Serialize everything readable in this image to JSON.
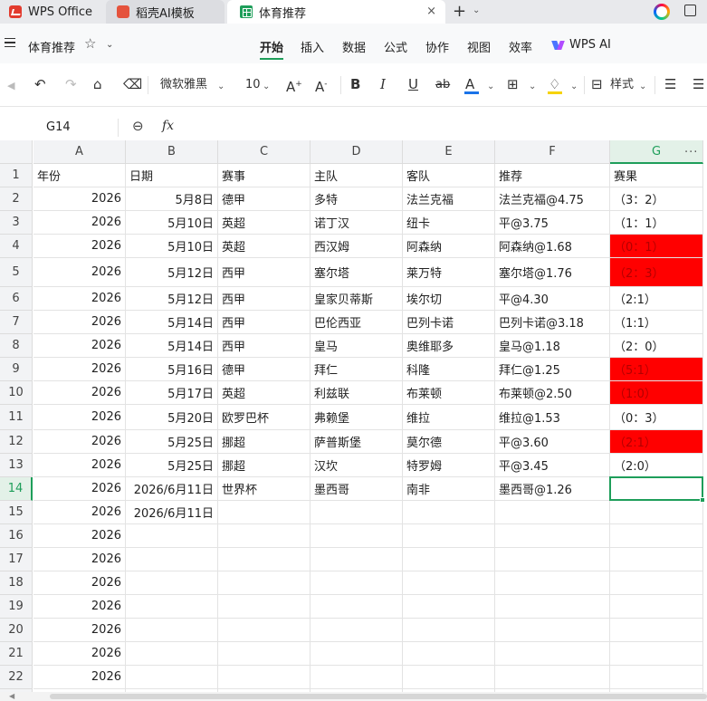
{
  "tabs": {
    "app": "WPS Office",
    "template": "稻壳AI模板",
    "document": "体育推荐",
    "close": "×",
    "new": "+",
    "new_menu": "⌄"
  },
  "menubar": {
    "doc_title": "体育推荐",
    "items": [
      "开始",
      "插入",
      "数据",
      "公式",
      "协作",
      "视图",
      "效率",
      "WPS AI"
    ],
    "active": "开始"
  },
  "toolbar": {
    "font_name": "微软雅黑",
    "font_size": "10",
    "style_label": "样式",
    "font_color": "#1a73e8",
    "fill_color": "#f6d300"
  },
  "formula_bar": {
    "cell_ref": "G14",
    "fx": "fx",
    "value": ""
  },
  "sheet": {
    "columns": [
      "A",
      "B",
      "C",
      "D",
      "E",
      "F",
      "G"
    ],
    "selected_column": "G",
    "selected_row": "14",
    "row_numbers": [
      "1",
      "2",
      "3",
      "4",
      "5",
      "6",
      "7",
      "8",
      "9",
      "10",
      "11",
      "12",
      "13",
      "14",
      "15",
      "16",
      "17",
      "18",
      "19",
      "20",
      "21",
      "22",
      "23"
    ],
    "header": [
      "年份",
      "日期",
      "赛事",
      "主队",
      "客队",
      "推荐",
      "赛果"
    ],
    "rows": [
      [
        "2026",
        "5月8日",
        "德甲",
        "多特",
        "法兰克福",
        "法兰克福@4.75",
        "（3：2）"
      ],
      [
        "2026",
        "5月10日",
        "英超",
        "诺丁汉",
        "纽卡",
        "平@3.75",
        "（1：1）"
      ],
      [
        "2026",
        "5月10日",
        "英超",
        "西汉姆",
        "阿森纳",
        "阿森纳@1.68",
        "（0：1）"
      ],
      [
        "2026",
        "5月12日",
        "西甲",
        "塞尔塔",
        "莱万特",
        "塞尔塔@1.76",
        "（2：3）"
      ],
      [
        "2026",
        "5月12日",
        "西甲",
        "皇家贝蒂斯",
        "埃尔切",
        "平@4.30",
        "（2:1）"
      ],
      [
        "2026",
        "5月14日",
        "西甲",
        "巴伦西亚",
        "巴列卡诺",
        "巴列卡诺@3.18",
        "（1:1）"
      ],
      [
        "2026",
        "5月14日",
        "西甲",
        "皇马",
        "奥维耶多",
        "皇马@1.18",
        "（2：0）"
      ],
      [
        "2026",
        "5月16日",
        "德甲",
        "拜仁",
        "科隆",
        "拜仁@1.25",
        "（5:1）"
      ],
      [
        "2026",
        "5月17日",
        "英超",
        "利兹联",
        "布莱顿",
        "布莱顿@2.50",
        "（1:0）"
      ],
      [
        "2026",
        "5月20日",
        "欧罗巴杯",
        "弗赖堡",
        "维拉",
        "维拉@1.53",
        "（0：3）"
      ],
      [
        "2026",
        "5月25日",
        "挪超",
        "萨普斯堡",
        "莫尔德",
        "平@3.60",
        "（2:1）"
      ],
      [
        "2026",
        "5月25日",
        "挪超",
        "汉坎",
        "特罗姆",
        "平@3.45",
        "（2:0）"
      ],
      [
        "2026",
        "2026/6月11日",
        "世界杯",
        "墨西哥",
        "南非",
        "墨西哥@1.26",
        ""
      ],
      [
        "2026",
        "2026/6月11日",
        "",
        "",
        "",
        "",
        ""
      ],
      [
        "2026",
        "",
        "",
        "",
        "",
        "",
        ""
      ],
      [
        "2026",
        "",
        "",
        "",
        "",
        "",
        ""
      ],
      [
        "2026",
        "",
        "",
        "",
        "",
        "",
        ""
      ],
      [
        "2026",
        "",
        "",
        "",
        "",
        "",
        ""
      ],
      [
        "2026",
        "",
        "",
        "",
        "",
        "",
        ""
      ],
      [
        "2026",
        "",
        "",
        "",
        "",
        "",
        ""
      ],
      [
        "2026",
        "",
        "",
        "",
        "",
        "",
        ""
      ],
      [
        "",
        "",
        "",
        "",
        "",
        "",
        ""
      ]
    ],
    "highlighted_rows": [
      2,
      3,
      7,
      8,
      10
    ],
    "highlight_color": "#ff0000"
  }
}
